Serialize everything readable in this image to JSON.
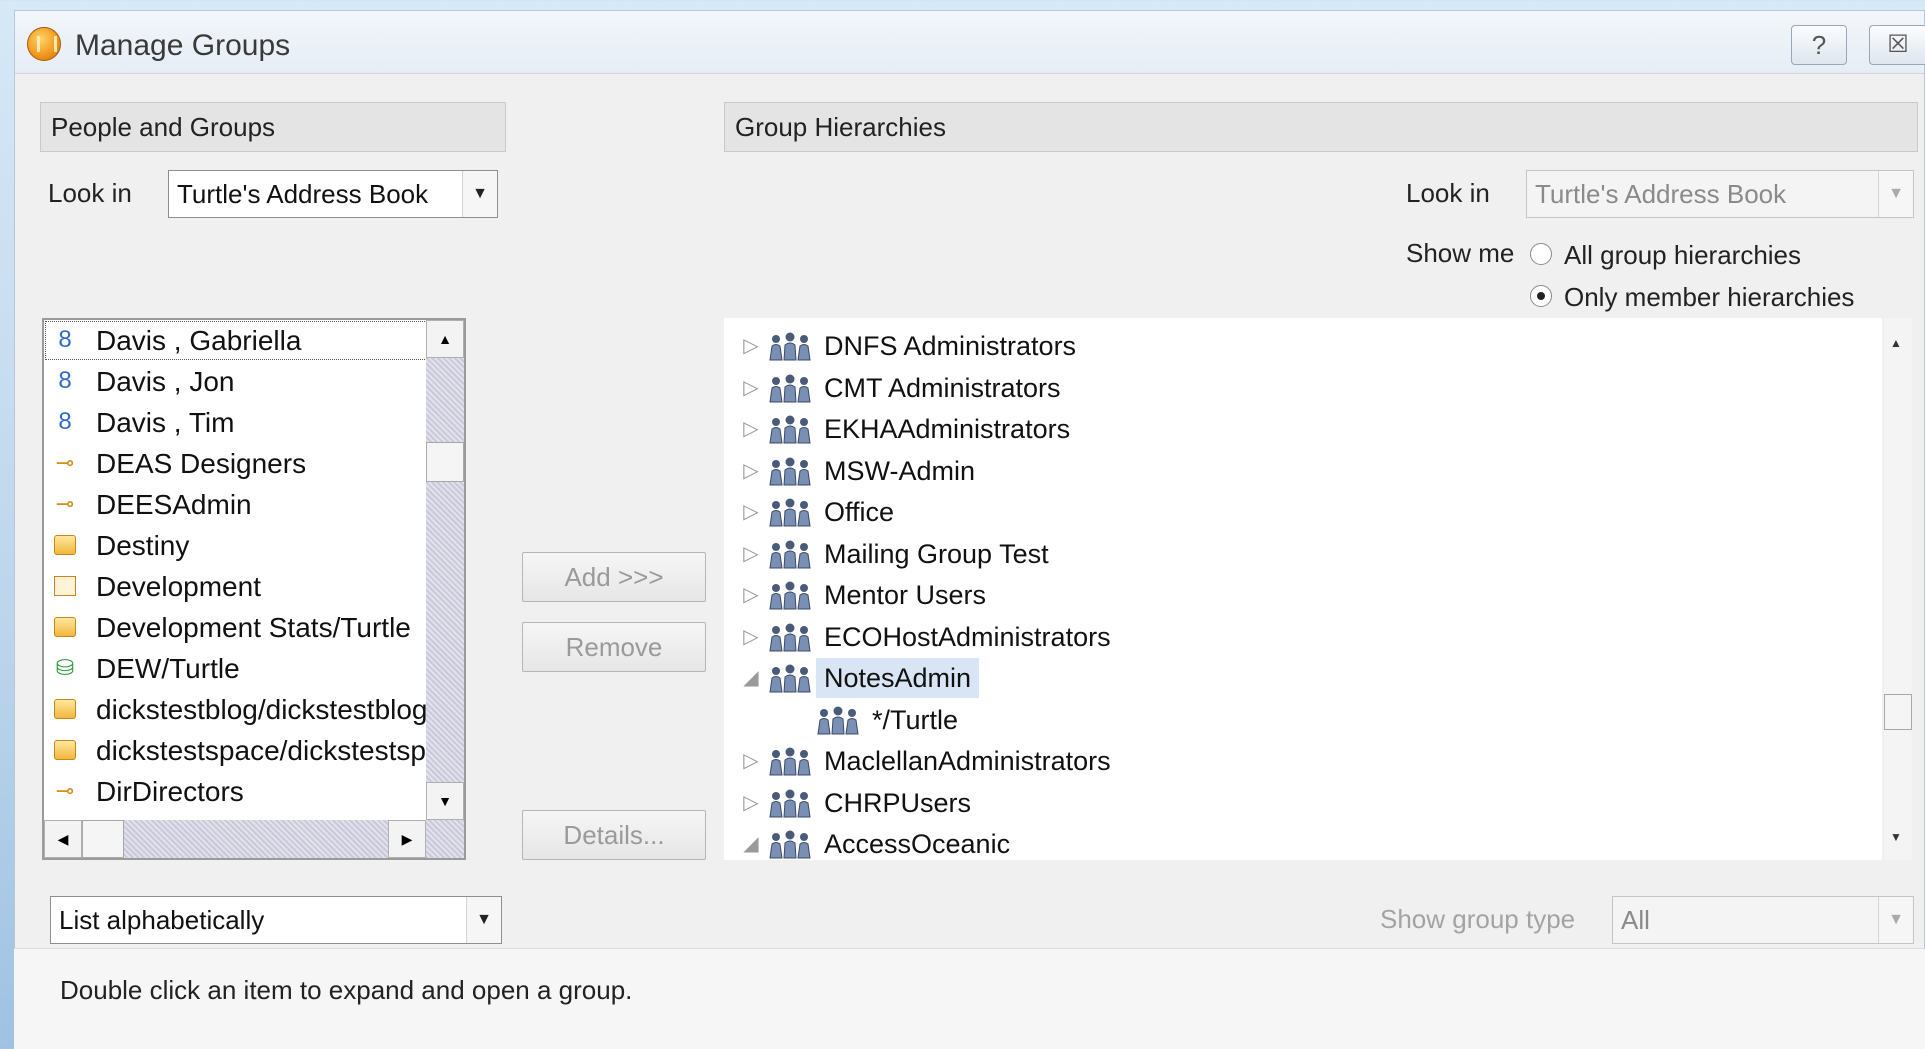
{
  "window": {
    "title": "Manage Groups",
    "help_label": "?",
    "close_label": "☒"
  },
  "left": {
    "header": "People and Groups",
    "look_in_label": "Look in",
    "look_in_value": "Turtle's Address Book",
    "items": [
      {
        "label": "Davis , Gabriella",
        "icon": "person"
      },
      {
        "label": "Davis , Jon",
        "icon": "person"
      },
      {
        "label": "Davis , Tim",
        "icon": "person"
      },
      {
        "label": "DEAS Designers",
        "icon": "key"
      },
      {
        "label": "DEESAdmin",
        "icon": "key"
      },
      {
        "label": "Destiny",
        "icon": "folder"
      },
      {
        "label": "Development",
        "icon": "book"
      },
      {
        "label": "Development Stats/Turtle",
        "icon": "folder"
      },
      {
        "label": "DEW/Turtle",
        "icon": "database"
      },
      {
        "label": "dickstestblog/dickstestblog",
        "icon": "folder"
      },
      {
        "label": "dickstestspace/dickstestspace",
        "icon": "folder"
      },
      {
        "label": "DirDirectors",
        "icon": "key"
      }
    ],
    "sort_value": "List alphabetically"
  },
  "actions": {
    "add": "Add >>>",
    "remove": "Remove",
    "details": "Details..."
  },
  "right": {
    "header": "Group Hierarchies",
    "look_in_label": "Look in",
    "look_in_value": "Turtle's Address Book",
    "show_me_label": "Show me",
    "option_all": "All group hierarchies",
    "option_member": "Only member hierarchies",
    "selected_option": "Only member hierarchies",
    "tree": [
      {
        "label": "DNFS Administrators",
        "expanded": false,
        "level": 0
      },
      {
        "label": "CMT Administrators",
        "expanded": false,
        "level": 0
      },
      {
        "label": "EKHAAdministrators",
        "expanded": false,
        "level": 0
      },
      {
        "label": "MSW-Admin",
        "expanded": false,
        "level": 0
      },
      {
        "label": "Office",
        "expanded": false,
        "level": 0
      },
      {
        "label": "Mailing Group Test",
        "expanded": false,
        "level": 0
      },
      {
        "label": "Mentor Users",
        "expanded": false,
        "level": 0
      },
      {
        "label": "ECOHostAdministrators",
        "expanded": false,
        "level": 0
      },
      {
        "label": "NotesAdmin",
        "expanded": true,
        "level": 0,
        "selected": true
      },
      {
        "label": "*/Turtle",
        "expanded": false,
        "level": 1
      },
      {
        "label": "MaclellanAdministrators",
        "expanded": false,
        "level": 0
      },
      {
        "label": "CHRPUsers",
        "expanded": false,
        "level": 0
      },
      {
        "label": "AccessOceanic",
        "expanded": true,
        "level": 0
      }
    ],
    "show_group_type_label": "Show group type",
    "show_group_type_value": "All"
  },
  "status": "Double click an item to expand and open a group."
}
